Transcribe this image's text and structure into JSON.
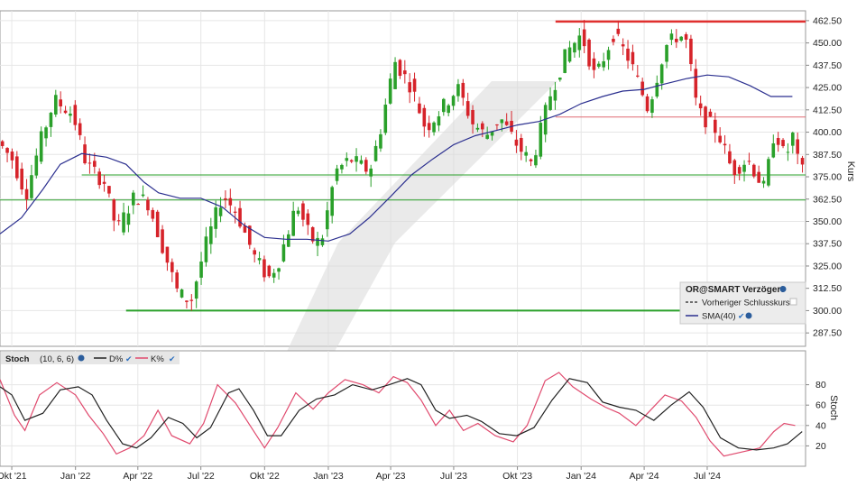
{
  "chart_data": [
    {
      "type": "candlestick",
      "ylabel": "Kurs",
      "ylim": [
        280,
        468
      ],
      "y_ticks": [
        287.5,
        300,
        312.5,
        325,
        337.5,
        350,
        362.5,
        375,
        387.5,
        400,
        412.5,
        425,
        437.5,
        450,
        462.5
      ],
      "y_tick_labels": [
        "287.50",
        "300.00",
        "312.50",
        "325.00",
        "337.50",
        "350.00",
        "362.50",
        "375.00",
        "387.50",
        "400.00",
        "412.50",
        "425.00",
        "437.50",
        "450.00",
        "462.50"
      ],
      "x_range": [
        "2021-09-14",
        "2024-11-20"
      ],
      "x_ticks": [
        "2021-10-01",
        "2022-01-01",
        "2022-04-01",
        "2022-07-01",
        "2022-10-01",
        "2023-01-01",
        "2023-04-01",
        "2023-07-01",
        "2023-10-01",
        "2024-01-01",
        "2024-04-01",
        "2024-07-01"
      ],
      "x_tick_labels": [
        "Okt '21",
        "Jan '22",
        "Apr '22",
        "Jul '22",
        "Okt '22",
        "Jan '23",
        "Apr '23",
        "Jul '23",
        "Okt '23",
        "Jan '24",
        "Apr '24",
        "Jul '24"
      ],
      "grid": true,
      "candle_colors": {
        "up": "#2aa02a",
        "down": "#d6232a"
      },
      "price_path": [
        [
          "2021-09-14",
          395
        ],
        [
          "2021-10-05",
          385
        ],
        [
          "2021-10-25",
          365
        ],
        [
          "2021-11-15",
          395
        ],
        [
          "2021-12-05",
          418
        ],
        [
          "2022-01-01",
          410
        ],
        [
          "2022-01-20",
          382
        ],
        [
          "2022-02-15",
          372
        ],
        [
          "2022-03-05",
          345
        ],
        [
          "2022-04-01",
          365
        ],
        [
          "2022-04-20",
          360
        ],
        [
          "2022-05-15",
          330
        ],
        [
          "2022-06-01",
          310
        ],
        [
          "2022-06-20",
          305
        ],
        [
          "2022-07-10",
          335
        ],
        [
          "2022-08-05",
          365
        ],
        [
          "2022-08-25",
          355
        ],
        [
          "2022-09-20",
          330
        ],
        [
          "2022-10-10",
          318
        ],
        [
          "2022-10-25",
          328
        ],
        [
          "2022-11-20",
          360
        ],
        [
          "2022-12-10",
          340
        ],
        [
          "2022-12-25",
          338
        ],
        [
          "2023-01-15",
          378
        ],
        [
          "2023-02-05",
          385
        ],
        [
          "2023-03-05",
          378
        ],
        [
          "2023-03-20",
          400
        ],
        [
          "2023-04-10",
          440
        ],
        [
          "2023-05-05",
          425
        ],
        [
          "2023-05-25",
          402
        ],
        [
          "2023-06-15",
          412
        ],
        [
          "2023-07-10",
          425
        ],
        [
          "2023-08-01",
          405
        ],
        [
          "2023-08-20",
          398
        ],
        [
          "2023-09-10",
          408
        ],
        [
          "2023-09-30",
          395
        ],
        [
          "2023-10-25",
          382
        ],
        [
          "2023-11-20",
          420
        ],
        [
          "2023-12-15",
          445
        ],
        [
          "2024-01-05",
          455
        ],
        [
          "2024-01-25",
          430
        ],
        [
          "2024-02-20",
          455
        ],
        [
          "2024-03-15",
          440
        ],
        [
          "2024-04-10",
          413
        ],
        [
          "2024-05-05",
          448
        ],
        [
          "2024-05-25",
          455
        ],
        [
          "2024-06-05",
          450
        ],
        [
          "2024-06-20",
          412
        ],
        [
          "2024-07-20",
          400
        ],
        [
          "2024-08-10",
          378
        ],
        [
          "2024-09-01",
          385
        ],
        [
          "2024-09-25",
          368
        ],
        [
          "2024-10-10",
          402
        ],
        [
          "2024-10-25",
          385
        ],
        [
          "2024-11-05",
          398
        ],
        [
          "2024-11-15",
          378
        ]
      ],
      "sma40": [
        [
          "2021-09-14",
          343
        ],
        [
          "2021-10-15",
          352
        ],
        [
          "2021-11-15",
          368
        ],
        [
          "2021-12-10",
          382
        ],
        [
          "2022-01-10",
          388
        ],
        [
          "2022-02-15",
          386
        ],
        [
          "2022-03-15",
          382
        ],
        [
          "2022-04-10",
          372
        ],
        [
          "2022-05-01",
          366
        ],
        [
          "2022-06-01",
          363
        ],
        [
          "2022-07-01",
          363
        ],
        [
          "2022-08-01",
          358
        ],
        [
          "2022-09-01",
          348
        ],
        [
          "2022-10-01",
          341
        ],
        [
          "2022-11-01",
          340
        ],
        [
          "2022-12-01",
          340
        ],
        [
          "2023-01-01",
          339
        ],
        [
          "2023-02-01",
          343
        ],
        [
          "2023-03-01",
          352
        ],
        [
          "2023-04-01",
          364
        ],
        [
          "2023-05-01",
          376
        ],
        [
          "2023-06-01",
          385
        ],
        [
          "2023-07-01",
          393
        ],
        [
          "2023-08-01",
          398
        ],
        [
          "2023-09-01",
          401
        ],
        [
          "2023-10-01",
          404
        ],
        [
          "2023-11-01",
          406
        ],
        [
          "2023-12-01",
          410
        ],
        [
          "2024-01-01",
          416
        ],
        [
          "2024-02-01",
          420
        ],
        [
          "2024-03-01",
          423
        ],
        [
          "2024-04-01",
          424
        ],
        [
          "2024-05-01",
          427
        ],
        [
          "2024-06-01",
          430
        ],
        [
          "2024-07-01",
          432
        ],
        [
          "2024-08-01",
          431
        ],
        [
          "2024-09-01",
          426
        ],
        [
          "2024-10-01",
          420
        ],
        [
          "2024-11-01",
          420
        ]
      ],
      "horizontal_lines": [
        {
          "value": 462,
          "from": "2023-11-25",
          "to": "2024-11-20",
          "color": "#e0302f",
          "width": 2.5
        },
        {
          "value": 408.5,
          "from": "2023-11-25",
          "to": "2024-11-20",
          "color": "#e06a72",
          "width": 1
        },
        {
          "value": 376,
          "from": "2022-01-10",
          "to": "2024-11-20",
          "color": "#2aa02a",
          "width": 1
        },
        {
          "value": 362,
          "from": "2021-09-14",
          "to": "2024-11-20",
          "color": "#2aa02a",
          "width": 1
        },
        {
          "value": 300,
          "from": "2022-03-15",
          "to": "2024-11-20",
          "color": "#2aa02a",
          "width": 2
        }
      ],
      "legend": {
        "position": "bottom-right",
        "title": "OR@SMART Verzögert",
        "items": [
          {
            "name": "Vorheriger Schlusskurs",
            "color": "#222222",
            "style": "dashed"
          },
          {
            "name": "SMA(40)",
            "color": "#2b2f8f",
            "style": "solid"
          }
        ]
      }
    },
    {
      "type": "line",
      "title": "Stoch",
      "params": "(10, 6, 6)",
      "ylabel": "Stoch",
      "ylim": [
        0,
        100
      ],
      "y_ticks": [
        20,
        40,
        60,
        80
      ],
      "y_tick_labels": [
        "20",
        "40",
        "60",
        "80"
      ],
      "series": [
        {
          "name": "D%",
          "color": "#222222",
          "points": [
            [
              "2021-09-14",
              78
            ],
            [
              "2021-10-01",
              70
            ],
            [
              "2021-10-20",
              45
            ],
            [
              "2021-11-15",
              52
            ],
            [
              "2021-12-10",
              75
            ],
            [
              "2022-01-05",
              78
            ],
            [
              "2022-01-25",
              70
            ],
            [
              "2022-02-15",
              45
            ],
            [
              "2022-03-10",
              22
            ],
            [
              "2022-03-30",
              18
            ],
            [
              "2022-04-20",
              28
            ],
            [
              "2022-05-15",
              48
            ],
            [
              "2022-06-05",
              42
            ],
            [
              "2022-06-25",
              28
            ],
            [
              "2022-07-15",
              38
            ],
            [
              "2022-08-10",
              72
            ],
            [
              "2022-08-25",
              76
            ],
            [
              "2022-09-15",
              55
            ],
            [
              "2022-10-05",
              30
            ],
            [
              "2022-10-25",
              30
            ],
            [
              "2022-11-20",
              55
            ],
            [
              "2022-12-15",
              66
            ],
            [
              "2023-01-10",
              70
            ],
            [
              "2023-02-05",
              80
            ],
            [
              "2023-03-05",
              75
            ],
            [
              "2023-03-30",
              80
            ],
            [
              "2023-04-25",
              86
            ],
            [
              "2023-05-15",
              80
            ],
            [
              "2023-06-05",
              55
            ],
            [
              "2023-06-25",
              47
            ],
            [
              "2023-07-20",
              50
            ],
            [
              "2023-08-10",
              44
            ],
            [
              "2023-09-05",
              32
            ],
            [
              "2023-09-30",
              30
            ],
            [
              "2023-10-25",
              38
            ],
            [
              "2023-11-20",
              65
            ],
            [
              "2023-12-15",
              86
            ],
            [
              "2024-01-10",
              82
            ],
            [
              "2024-02-01",
              63
            ],
            [
              "2024-02-25",
              58
            ],
            [
              "2024-03-20",
              55
            ],
            [
              "2024-04-15",
              45
            ],
            [
              "2024-05-10",
              60
            ],
            [
              "2024-06-05",
              73
            ],
            [
              "2024-06-25",
              58
            ],
            [
              "2024-07-20",
              28
            ],
            [
              "2024-08-15",
              18
            ],
            [
              "2024-09-10",
              16
            ],
            [
              "2024-10-05",
              18
            ],
            [
              "2024-10-25",
              22
            ],
            [
              "2024-11-15",
              34
            ]
          ]
        },
        {
          "name": "K%",
          "color": "#e04a6e",
          "points": [
            [
              "2021-09-14",
              85
            ],
            [
              "2021-10-05",
              50
            ],
            [
              "2021-10-20",
              35
            ],
            [
              "2021-11-10",
              70
            ],
            [
              "2021-12-05",
              82
            ],
            [
              "2022-01-01",
              70
            ],
            [
              "2022-01-20",
              50
            ],
            [
              "2022-02-10",
              32
            ],
            [
              "2022-03-01",
              12
            ],
            [
              "2022-03-20",
              18
            ],
            [
              "2022-04-10",
              30
            ],
            [
              "2022-04-30",
              55
            ],
            [
              "2022-05-20",
              30
            ],
            [
              "2022-06-15",
              22
            ],
            [
              "2022-07-05",
              42
            ],
            [
              "2022-07-25",
              80
            ],
            [
              "2022-08-20",
              62
            ],
            [
              "2022-09-10",
              40
            ],
            [
              "2022-10-01",
              18
            ],
            [
              "2022-10-20",
              38
            ],
            [
              "2022-11-15",
              72
            ],
            [
              "2022-12-10",
              56
            ],
            [
              "2023-01-01",
              72
            ],
            [
              "2023-01-25",
              85
            ],
            [
              "2023-02-20",
              80
            ],
            [
              "2023-03-15",
              72
            ],
            [
              "2023-04-05",
              88
            ],
            [
              "2023-04-25",
              82
            ],
            [
              "2023-05-15",
              65
            ],
            [
              "2023-06-05",
              40
            ],
            [
              "2023-06-25",
              55
            ],
            [
              "2023-07-15",
              35
            ],
            [
              "2023-08-05",
              42
            ],
            [
              "2023-08-30",
              30
            ],
            [
              "2023-09-25",
              24
            ],
            [
              "2023-10-15",
              40
            ],
            [
              "2023-11-10",
              84
            ],
            [
              "2023-11-30",
              92
            ],
            [
              "2023-12-20",
              78
            ],
            [
              "2024-01-15",
              66
            ],
            [
              "2024-02-05",
              58
            ],
            [
              "2024-02-25",
              52
            ],
            [
              "2024-03-20",
              40
            ],
            [
              "2024-04-10",
              55
            ],
            [
              "2024-05-01",
              70
            ],
            [
              "2024-05-25",
              64
            ],
            [
              "2024-06-15",
              48
            ],
            [
              "2024-07-05",
              25
            ],
            [
              "2024-07-25",
              10
            ],
            [
              "2024-08-20",
              14
            ],
            [
              "2024-09-15",
              18
            ],
            [
              "2024-10-05",
              34
            ],
            [
              "2024-10-20",
              42
            ],
            [
              "2024-11-05",
              40
            ]
          ]
        }
      ]
    }
  ]
}
